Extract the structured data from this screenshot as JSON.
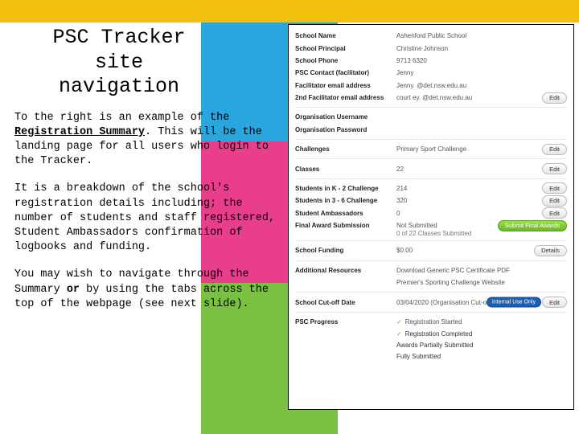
{
  "title_l1": "PSC Tracker",
  "title_l2": "site",
  "title_l3": "navigation",
  "para1_a": "To the right is an example of the ",
  "para1_strong": "Registration Summary",
  "para1_b": ". This will be the landing page for all users who login to the Tracker.",
  "para2": "It is a breakdown of the school's registration details including; the number of students and staff registered, Student Ambassadors confirmation of logbooks and funding.",
  "para3_a": "You may wish to navigate through the Summary ",
  "para3_or": "or",
  "para3_b": " by using the tabs across the top of the webpage (see next slide).",
  "fields": {
    "schoolName": {
      "label": "School Name",
      "value": "Ashenford Public School"
    },
    "principal": {
      "label": "School Principal",
      "value": "Christine Johnson"
    },
    "phone": {
      "label": "School Phone",
      "value": "9713 6320"
    },
    "pscContact": {
      "label": "PSC Contact (facilitator)",
      "value": "Jenny"
    },
    "facEmail": {
      "label": "Facilitator email address",
      "value": "Jenny.      @det.nsw.edu.au"
    },
    "facEmail2": {
      "label": "2nd Facilitator email address",
      "value": "court ey.     @det.nsw.edu.au",
      "btn": "Edit"
    },
    "orgUser": {
      "label": "Organisation Username",
      "value": ""
    },
    "orgPass": {
      "label": "Organisation Password",
      "value": ""
    },
    "challenges": {
      "label": "Challenges",
      "value": "Primary Sport Challenge",
      "btn": "Edit"
    },
    "classes": {
      "label": "Classes",
      "value": "22",
      "btn": "Edit"
    },
    "k2": {
      "label": "Students in K - 2 Challenge",
      "value": "214",
      "btn": "Edit"
    },
    "s36": {
      "label": "Students in 3 - 6 Challenge",
      "value": "320",
      "btn": "Edit"
    },
    "amb": {
      "label": "Student Ambassadors",
      "value": "0",
      "btn": "Edit"
    },
    "final": {
      "label": "Final Award Submission",
      "value": "Not Submitted",
      "btnGreen": "Submit Final Awards",
      "sub": "0 of 22 Classes Submitted"
    },
    "funding": {
      "label": "School Funding",
      "value": "$0.00",
      "btn": "Details"
    },
    "resources": {
      "label": "Additional Resources",
      "link1": "Download Generic PSC Certificate PDF",
      "link2": "Premier's Sporting Challenge Website"
    },
    "cutoff": {
      "label": "School Cut-off Date",
      "value": "03/04/2020 (Organisation Cut-off)",
      "badge": "Internal Use Only",
      "btn": "Edit"
    },
    "progress": {
      "label": "PSC Progress",
      "items": [
        "Registration Started",
        "Registration Completed",
        "Awards Partially Submitted",
        "Fully Submitted"
      ]
    }
  }
}
